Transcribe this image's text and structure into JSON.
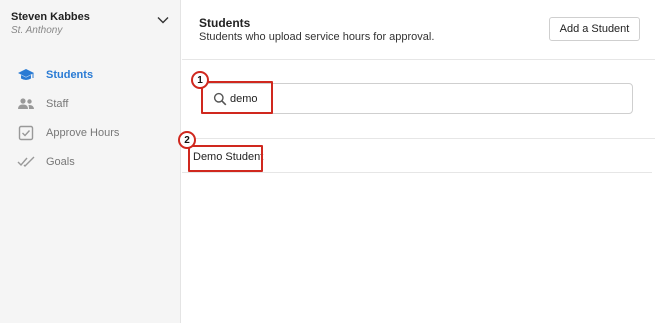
{
  "user": {
    "name": "Steven Kabbes",
    "org": "St. Anthony"
  },
  "nav": {
    "items": [
      {
        "label": "Students",
        "icon": "graduation-cap-icon",
        "active": true
      },
      {
        "label": "Staff",
        "icon": "users-icon",
        "active": false
      },
      {
        "label": "Approve Hours",
        "icon": "checkbox-icon",
        "active": false
      },
      {
        "label": "Goals",
        "icon": "double-check-icon",
        "active": false
      }
    ]
  },
  "header": {
    "title": "Students",
    "subtitle": "Students who upload service hours for approval.",
    "add_button_label": "Add a Student"
  },
  "search": {
    "value": "demo",
    "placeholder": ""
  },
  "results": [
    {
      "name": "Demo Student"
    }
  ],
  "annotations": [
    {
      "number": "1"
    },
    {
      "number": "2"
    }
  ],
  "colors": {
    "accent": "#2a7bd4",
    "annotation": "#d0281e",
    "sidebar_bg": "#f5f5f5"
  }
}
